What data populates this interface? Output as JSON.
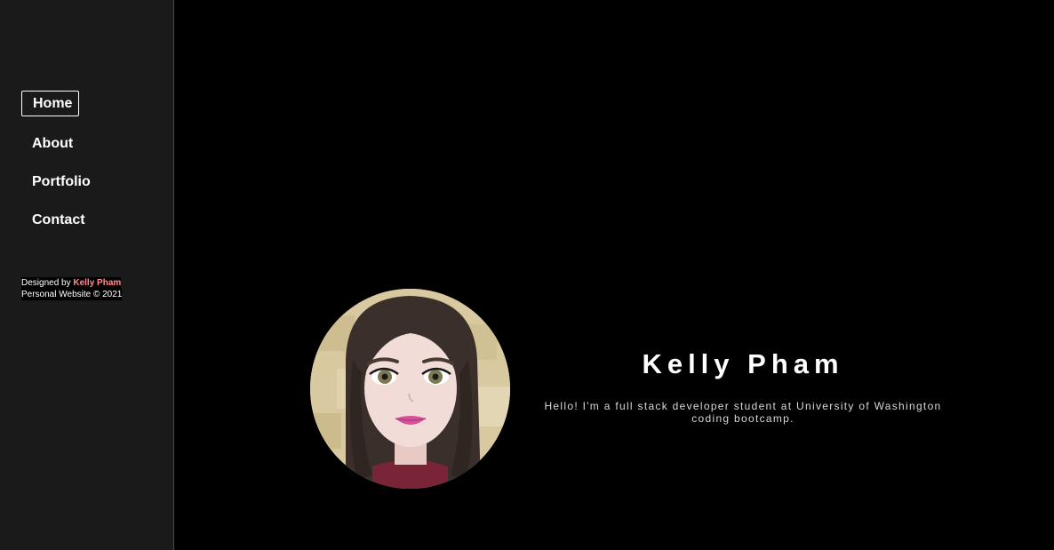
{
  "nav": {
    "items": [
      {
        "label": "Home",
        "active": true
      },
      {
        "label": "About",
        "active": false
      },
      {
        "label": "Portfolio",
        "active": false
      },
      {
        "label": "Contact",
        "active": false
      }
    ]
  },
  "credits": {
    "designed_by_prefix": "Designed by",
    "author": "Kelly Pham",
    "line2": "Personal Website © 2021"
  },
  "hero": {
    "name": "Kelly Pham",
    "intro": "Hello! I'm a full stack developer student at University of Washington coding bootcamp."
  },
  "colors": {
    "sidebar_bg": "#1a1a1a",
    "page_bg": "#000000",
    "author_accent": "#ff8c94"
  }
}
